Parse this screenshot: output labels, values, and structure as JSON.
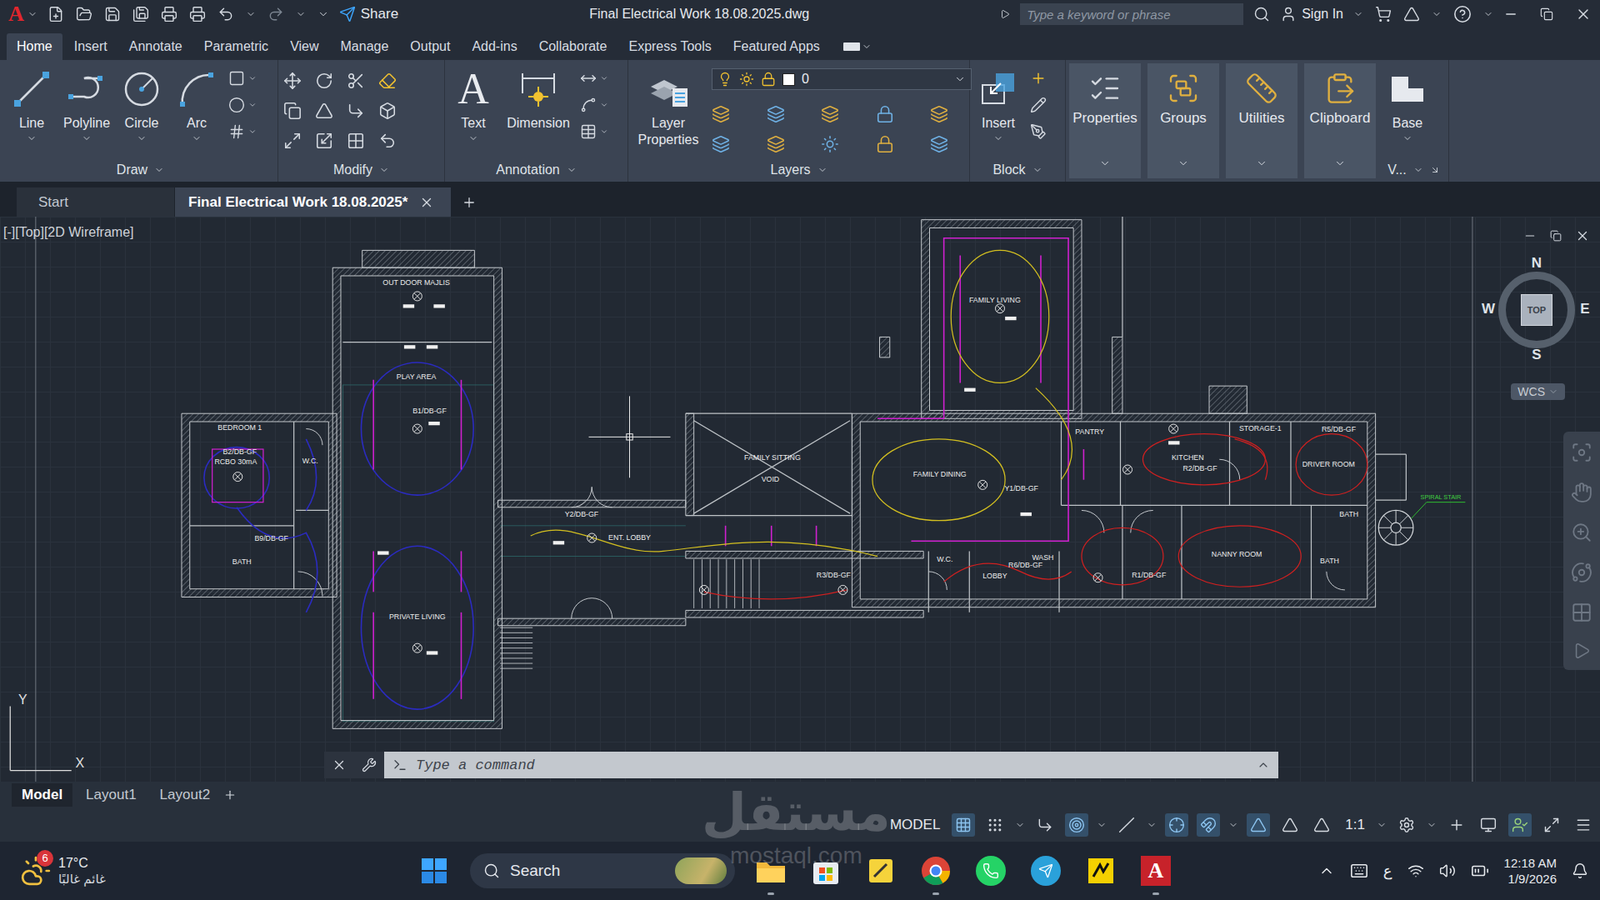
{
  "app": {
    "logo": "A",
    "share": "Share",
    "title": "Final Electrical Work 18.08.2025.dwg",
    "search_placeholder": "Type a keyword or phrase",
    "sign_in": "Sign In"
  },
  "menu_tabs": [
    {
      "label": "Home",
      "selected": true
    },
    {
      "label": "Insert",
      "selected": false
    },
    {
      "label": "Annotate",
      "selected": false
    },
    {
      "label": "Parametric",
      "selected": false
    },
    {
      "label": "View",
      "selected": false
    },
    {
      "label": "Manage",
      "selected": false
    },
    {
      "label": "Output",
      "selected": false
    },
    {
      "label": "Add-ins",
      "selected": false
    },
    {
      "label": "Collaborate",
      "selected": false
    },
    {
      "label": "Express Tools",
      "selected": false
    },
    {
      "label": "Featured Apps",
      "selected": false
    }
  ],
  "ribbon": {
    "draw": {
      "title": "Draw",
      "tools": [
        "Line",
        "Polyline",
        "Circle",
        "Arc"
      ]
    },
    "modify": {
      "title": "Modify"
    },
    "annotation": {
      "title": "Annotation",
      "text_tool": "Text",
      "text_glyph": "A",
      "dimension_tool": "Dimension"
    },
    "layers": {
      "title": "Layers",
      "tool": "Layer Properties",
      "current_layer": "0"
    },
    "block": {
      "title": "Block",
      "tool": "Insert"
    },
    "groups": [
      "Properties",
      "Groups",
      "Utilities",
      "Clipboard"
    ],
    "view": {
      "title": "V...",
      "tool": "Base"
    }
  },
  "doc_tabs": [
    {
      "label": "Start",
      "selected": false
    },
    {
      "label": "Final Electrical Work 18.08.2025*",
      "selected": true
    }
  ],
  "viewport": {
    "label": "[-][Top][2D Wireframe]",
    "viewcube": {
      "n": "N",
      "s": "S",
      "e": "E",
      "w": "W",
      "face": "TOP",
      "ucs": "WCS"
    },
    "axis": {
      "x": "X",
      "y": "Y"
    }
  },
  "drawing_labels": [
    "OUT DOOR MAJLIS",
    "PLAY AREA",
    "B1/DB-GF",
    "BEDROOM 1",
    "B2/DB-GF",
    "RCBO 30mA",
    "W.C.",
    "B9/DB-GF",
    "BATH",
    "PRIVATE LIVING",
    "Y2/DB-GF",
    "ENT. LOBBY",
    "FAMILY SITTING",
    "VOID",
    "FAMILY LIVING",
    "FAMILY DINING",
    "Y1/DB-GF",
    "R3/DB-GF",
    "W.C.",
    "R6/DB-GF",
    "WASH",
    "LOBBY",
    "PANTRY",
    "KITCHEN",
    "R2/DB-GF",
    "STORAGE-1",
    "R5/DB-GF",
    "DRIVER ROOM",
    "BATH",
    "NANNY ROOM",
    "R1/DB-GF",
    "BATH",
    "SPIRAL STAIR"
  ],
  "command_line": {
    "placeholder": "Type a command"
  },
  "layout_tabs": [
    {
      "label": "Model",
      "selected": true
    },
    {
      "label": "Layout1",
      "selected": false
    },
    {
      "label": "Layout2",
      "selected": false
    }
  ],
  "status_bar": {
    "mode": "MODEL",
    "scale": "1:1"
  },
  "watermark": {
    "brand": "مستقل",
    "site": "mostaql.com"
  },
  "taskbar": {
    "weather": {
      "badge": "6",
      "temp": "17°C",
      "condition": "غائم غالبًا"
    },
    "search": "Search",
    "language": "ع",
    "time": "12:18 AM",
    "date": "1/9/2026"
  }
}
